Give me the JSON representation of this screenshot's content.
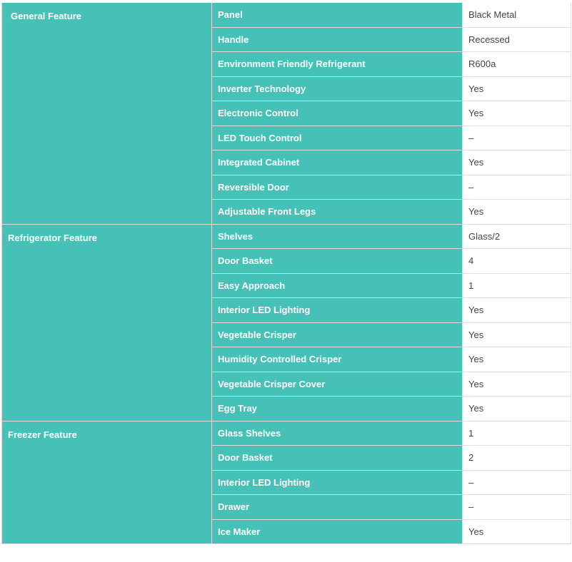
{
  "groups": [
    {
      "name": "General Feature",
      "rows": [
        {
          "feature": "Panel",
          "value": "Black Metal"
        },
        {
          "feature": "Handle",
          "value": "Recessed"
        },
        {
          "feature": "Environment Friendly Refrigerant",
          "value": "R600a"
        },
        {
          "feature": "Inverter Technology",
          "value": "Yes"
        },
        {
          "feature": "Electronic Control",
          "value": "Yes"
        },
        {
          "feature": "LED Touch Control",
          "value": "–"
        },
        {
          "feature": "Integrated Cabinet",
          "value": "Yes"
        },
        {
          "feature": "Reversible Door",
          "value": "–"
        },
        {
          "feature": "Adjustable Front Legs",
          "value": "Yes"
        }
      ]
    },
    {
      "name": "Refrigerator Feature",
      "rows": [
        {
          "feature": "Shelves",
          "value": "Glass/2"
        },
        {
          "feature": "Door Basket",
          "value": "4"
        },
        {
          "feature": "Easy Approach",
          "value": "1"
        },
        {
          "feature": "Interior LED Lighting",
          "value": "Yes"
        },
        {
          "feature": "Vegetable Crisper",
          "value": "Yes"
        },
        {
          "feature": "Humidity Controlled Crisper",
          "value": "Yes"
        },
        {
          "feature": "Vegetable Crisper Cover",
          "value": "Yes"
        },
        {
          "feature": "Egg Tray",
          "value": "Yes"
        }
      ]
    },
    {
      "name": "Freezer Feature",
      "rows": [
        {
          "feature": "Glass Shelves",
          "value": "1"
        },
        {
          "feature": "Door Basket",
          "value": "2"
        },
        {
          "feature": "Interior LED Lighting",
          "value": "–"
        },
        {
          "feature": "Drawer",
          "value": "–"
        },
        {
          "feature": "Ice Maker",
          "value": "Yes"
        }
      ]
    }
  ]
}
